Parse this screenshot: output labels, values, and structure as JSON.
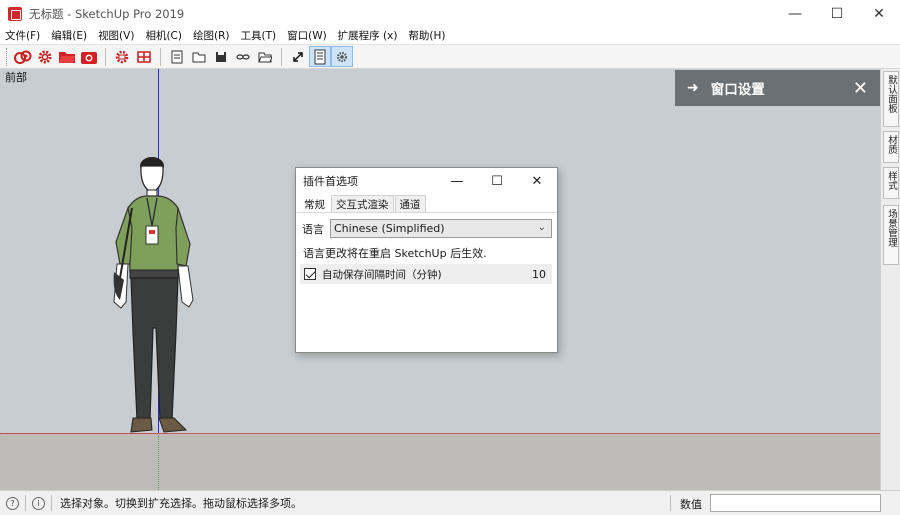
{
  "window": {
    "title": "无标题 - SketchUp Pro 2019",
    "minimize_glyph": "—",
    "maximize_glyph": "☐",
    "close_glyph": "✕"
  },
  "menu": [
    "文件(F)",
    "编辑(E)",
    "视图(V)",
    "相机(C)",
    "绘图(R)",
    "工具(T)",
    "窗口(W)",
    "扩展程序 (x)",
    "帮助(H)"
  ],
  "toolbar": {
    "icons": [
      "getting-started-icon",
      "settings-gear-icon",
      "open-folder-icon",
      "extension-warehouse-icon",
      "extension-manager-icon",
      "components-icon",
      "document-icon",
      "folder-icon",
      "save-icon",
      "unlink-icon",
      "open-file-icon",
      "resize-icon",
      "outliner-icon",
      "preferences-icon"
    ]
  },
  "viewport": {
    "scene_label": "前部",
    "colors": {
      "sky": "#c7cdd1",
      "ground": "#bdbcb9",
      "blue_axis": "#2a2ad0",
      "red_axis": "#c85a5a"
    }
  },
  "tray": {
    "title": "窗口设置",
    "arrow": "➜",
    "close": "✕"
  },
  "side_tabs": [
    "默认面板",
    "材质",
    "样式",
    "场景管理"
  ],
  "dialog": {
    "title": "插件首选项",
    "minimize": "—",
    "maximize": "☐",
    "close": "✕",
    "tabs": [
      "常规",
      "交互式渲染",
      "通道"
    ],
    "active_tab": "常规",
    "language_label": "语言",
    "language_value": "Chinese (Simplified)",
    "language_caret": "⌄",
    "language_note": "语言更改将在重启 SketchUp 后生效.",
    "autosave": {
      "checked": true,
      "label": "自动保存间隔时间（分钟)",
      "value": "10"
    }
  },
  "statusbar": {
    "info_icon_1": "?",
    "info_icon_2": "i",
    "message": "选择对象。切换到扩充选择。拖动鼠标选择多项。",
    "value_label": "数值",
    "value": ""
  }
}
